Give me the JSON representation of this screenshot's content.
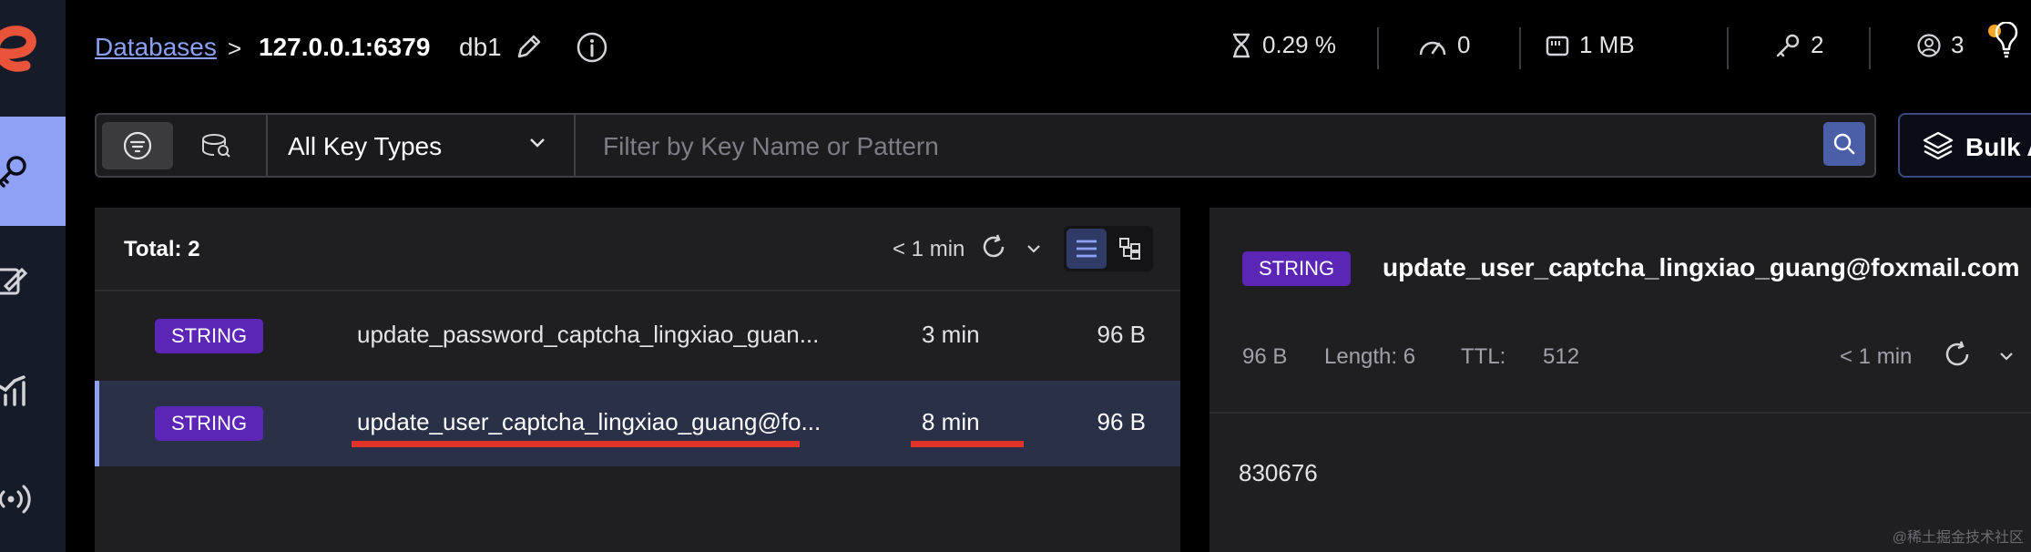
{
  "header": {
    "breadcrumb_link": "Databases",
    "breadcrumb_sep": ">",
    "host": "127.0.0.1:6379",
    "db": "db1",
    "stats": {
      "cpu": "0.29 %",
      "ops": "0",
      "memory": "1 MB",
      "keys": "2",
      "clients": "3"
    }
  },
  "filter": {
    "key_type_label": "All Key Types",
    "search_placeholder": "Filter by Key Name or Pattern",
    "bulk_label": "Bulk A"
  },
  "list": {
    "total": "Total: 2",
    "refresh_time": "< 1 min",
    "rows": [
      {
        "type": "STRING",
        "key": "update_password_captcha_lingxiao_guan...",
        "ttl": "3 min",
        "size": "96 B"
      },
      {
        "type": "STRING",
        "key": "update_user_captcha_lingxiao_guang@fo...",
        "ttl": "8 min",
        "size": "96 B"
      }
    ]
  },
  "detail": {
    "type": "STRING",
    "key": "update_user_captcha_lingxiao_guang@foxmail.com",
    "size": "96 B",
    "length": "Length: 6",
    "ttl_label": "TTL:",
    "ttl_value": "512",
    "refresh_time": "< 1 min",
    "value": "830676"
  },
  "watermark": "@稀土掘金技术社区",
  "colors": {
    "accent": "#8fa1f7",
    "string_badge": "#5b26b5",
    "highlight": "#e0342b",
    "logo": "#e8533a"
  }
}
